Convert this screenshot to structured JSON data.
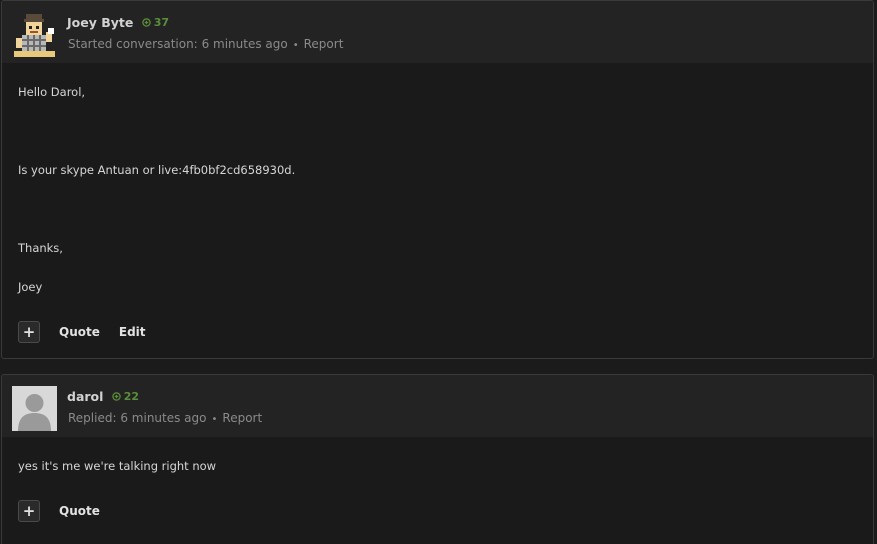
{
  "posts": [
    {
      "author": "Joey Byte",
      "reputation": "37",
      "action_text": "Started conversation:",
      "time": "6 minutes ago",
      "report_label": "Report",
      "body_lines": [
        "Hello Darol,",
        "Is your skype Antuan or live:4fb0bf2cd658930d.",
        "Thanks,",
        "Joey"
      ],
      "actions": {
        "plus_label": "+",
        "quote_label": "Quote",
        "edit_label": "Edit"
      }
    },
    {
      "author": "darol",
      "reputation": "22",
      "action_text": "Replied:",
      "time": "6 minutes ago",
      "report_label": "Report",
      "body_lines": [
        "yes it's  me we're talking right now"
      ],
      "actions": {
        "plus_label": "+",
        "quote_label": "Quote"
      }
    }
  ],
  "colors": {
    "background": "#1b1b1b",
    "header": "#232323",
    "reputation": "#5a8f3a",
    "text": "#d6d6d6",
    "meta": "#8a8a8a"
  },
  "icons": {
    "reputation": "plus-circle-icon",
    "avatar_1": "pixel-character-avatar",
    "avatar_2": "default-user-silhouette"
  }
}
